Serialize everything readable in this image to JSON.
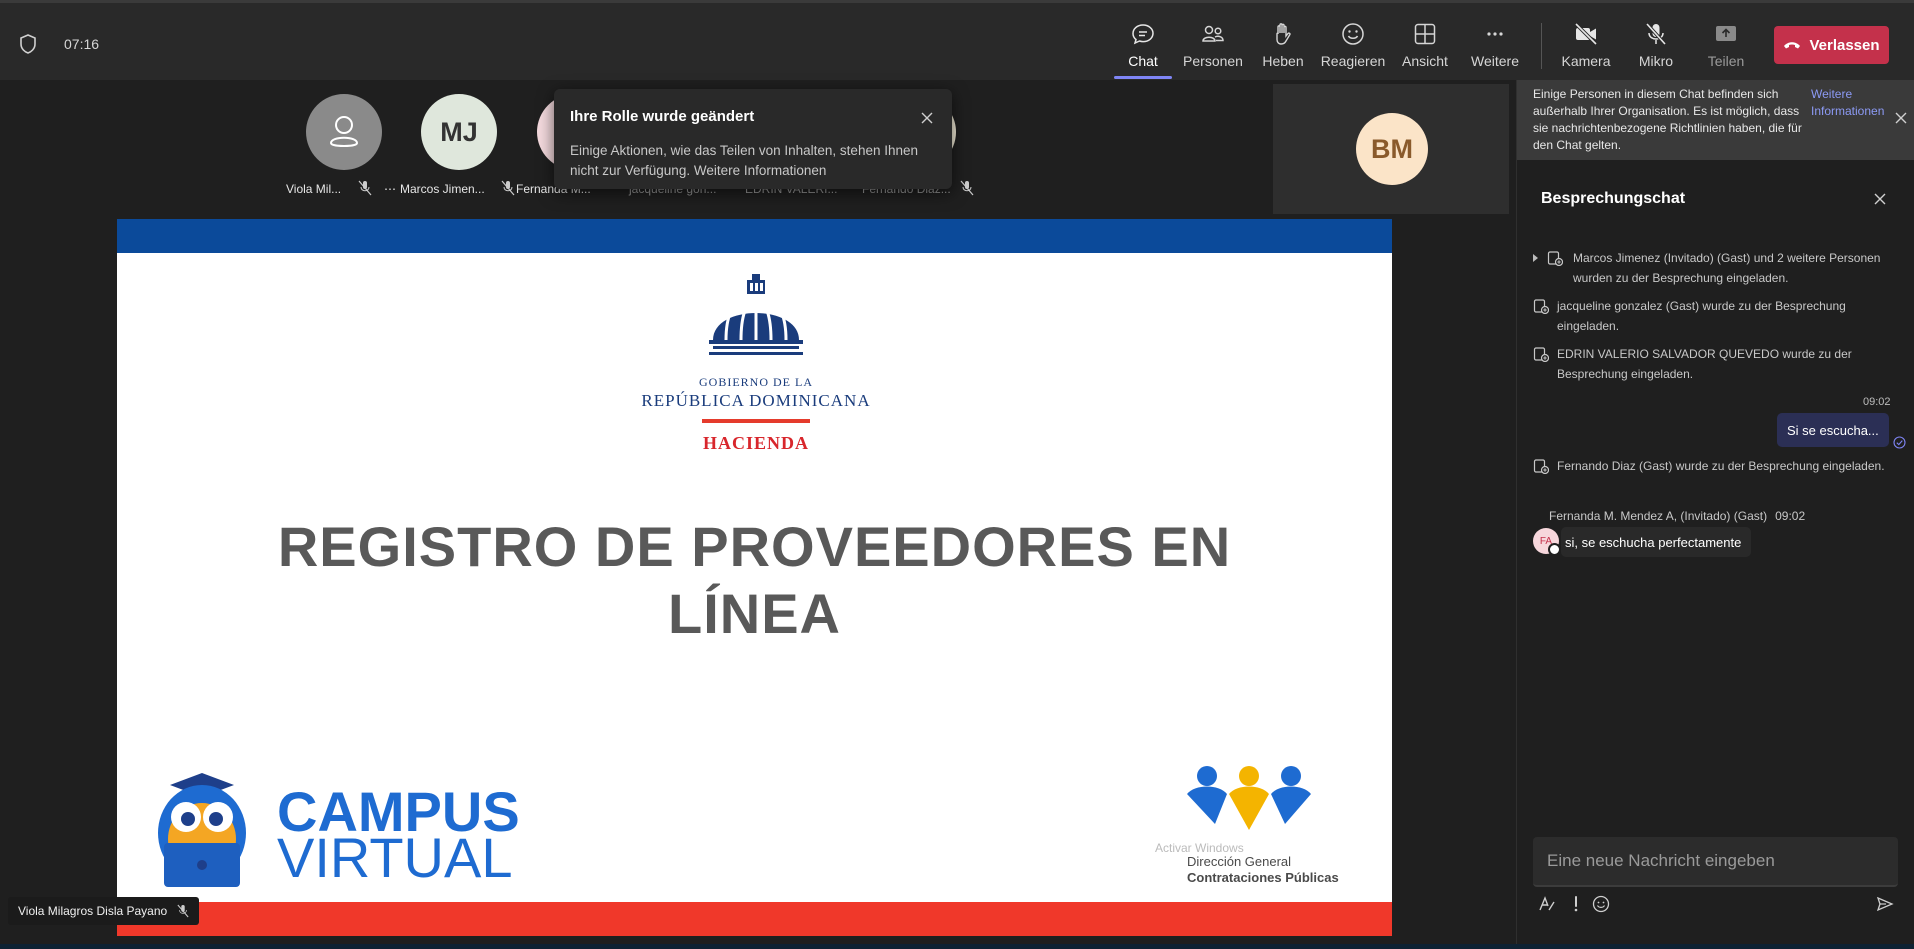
{
  "topbar": {
    "timer": "07:16",
    "tools": [
      {
        "label": "Chat",
        "icon": "chat-icon"
      },
      {
        "label": "Personen",
        "icon": "people-icon"
      },
      {
        "label": "Heben",
        "icon": "raise-hand-icon"
      },
      {
        "label": "Reagieren",
        "icon": "smiley-icon"
      },
      {
        "label": "Ansicht",
        "icon": "grid-view-icon"
      },
      {
        "label": "Weitere",
        "icon": "more-icon"
      },
      {
        "label": "Kamera",
        "icon": "camera-off-icon"
      },
      {
        "label": "Mikro",
        "icon": "mic-off-icon"
      },
      {
        "label": "Teilen",
        "icon": "share-icon"
      }
    ],
    "leave_label": "Verlassen",
    "leave_color": "#c4314b",
    "active_tool_accent": "#7f85f5"
  },
  "participants": [
    {
      "name": "Viola Mil...",
      "initials": ""
    },
    {
      "name": "Marcos Jimen...",
      "initials": "MJ"
    },
    {
      "name": "Fernanda M...",
      "initials": ""
    },
    {
      "name": "jacqueline gon...",
      "initials": ""
    },
    {
      "name": "EDRIN VALERI...",
      "initials": ""
    },
    {
      "name": "Fernando Diaz...",
      "initials": ""
    }
  ],
  "self_tile": {
    "initials": "BM"
  },
  "toast": {
    "title": "Ihre Rolle wurde geändert",
    "text": "Einige Aktionen, wie das Teilen von Inhalten, stehen Ihnen nicht zur Verfügung. Weitere Informationen"
  },
  "slide": {
    "gov_line1": "GOBIERNO DE LA",
    "gov_line2": "REPÚBLICA DOMINICANA",
    "gov_line3": "HACIENDA",
    "title": "REGISTRO DE PROVEEDORES EN LÍNEA",
    "campus_line1": "CAMPUS",
    "campus_line2": "VIRTUAL",
    "dgcp_line1": "Dirección General",
    "dgcp_line2": "Contrataciones Públicas",
    "watermark": "Activar Windows",
    "top_band_color": "#0b4a9a",
    "bottom_band_color": "#f0382a"
  },
  "my_label": "Viola Milagros Disla Payano",
  "panel": {
    "banner_text": "Einige Personen in diesem Chat befinden sich außerhalb Ihrer Organisation. Es ist möglich, dass sie nachrichtenbezogene Richtlinien haben, die für den Chat gelten.",
    "banner_link": "Weitere Informationen",
    "chat_title": "Besprechungschat",
    "system_messages": [
      "Marcos Jimenez (Invitado) (Gast) und 2 weitere Personen wurden zu der Besprechung eingeladen.",
      "jacqueline gonzalez (Gast) wurde zu der Besprechung eingeladen.",
      "EDRIN VALERIO SALVADOR QUEVEDO wurde zu der Besprechung eingeladen."
    ],
    "my_message": {
      "time": "09:02",
      "text": "Si se escucha..."
    },
    "system_message_after": "Fernando Diaz (Gast) wurde zu der Besprechung eingeladen.",
    "other_message": {
      "sender": "Fernanda M. Mendez A, (Invitado) (Gast)",
      "time": "09:02",
      "initials": "FA",
      "text": "si, se eschucha perfectamente"
    },
    "compose_placeholder": "Eine neue Nachricht eingeben"
  }
}
